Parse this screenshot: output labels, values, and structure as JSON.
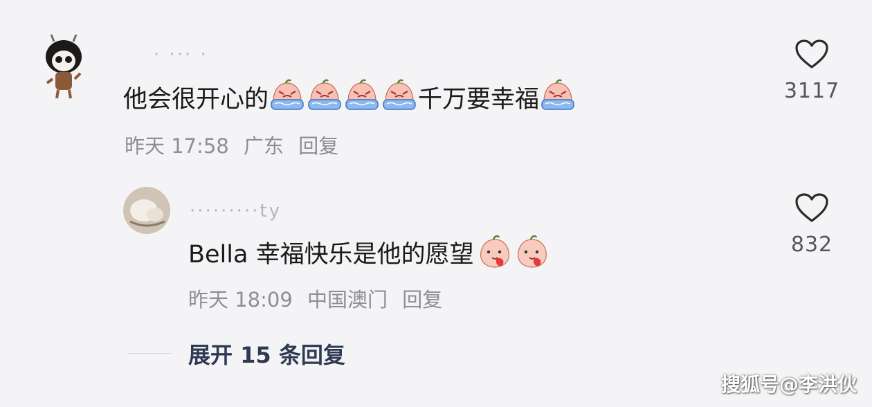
{
  "comments": [
    {
      "username": "· ··· ·",
      "text_part1": "他会很开心的",
      "text_part2": "千万要幸福",
      "time": "昨天 17:58",
      "location": "广东",
      "reply_label": "回复",
      "like_count": "3117",
      "emoji_name": "crying-peach-emoji"
    },
    {
      "username": "·········ty",
      "text": "Bella 幸福快乐是他的愿望",
      "time": "昨天 18:09",
      "location": "中国澳门",
      "reply_label": "回复",
      "like_count": "832",
      "emoji_name": "blushing-peach-emoji"
    }
  ],
  "expand_replies": "展开 15 条回复",
  "watermark": "搜狐号@李洪伙",
  "colors": {
    "background": "#f4f4f6",
    "text": "#1a1a1a",
    "meta": "#8e8e93",
    "expand": "#2e3a52"
  }
}
